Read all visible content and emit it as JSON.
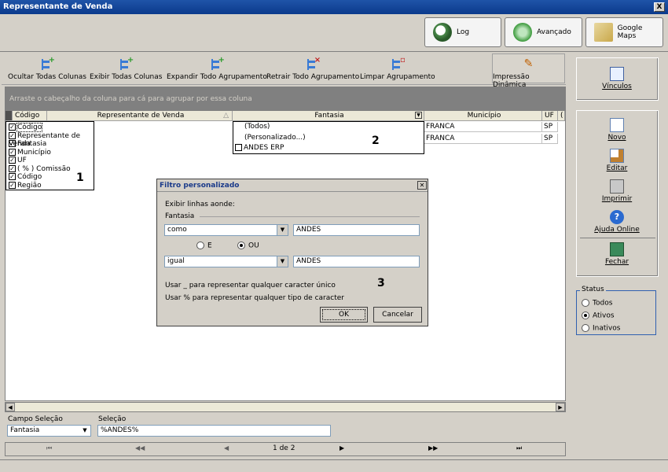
{
  "window": {
    "title": "Representante de Venda",
    "close": "X"
  },
  "top_buttons": [
    {
      "label": "Log",
      "icon": "magnifier-icon"
    },
    {
      "label": "Avançado",
      "icon": "globe-arrow-icon"
    },
    {
      "label": "Google Maps",
      "icon": "map-icon"
    }
  ],
  "toolbar": {
    "hide_all_columns": "Ocultar Todas Colunas",
    "show_all_columns": "Exibir Todas  Colunas",
    "expand_groups": "Expandir Todo Agrupamento",
    "collapse_groups": "Retrair Todo Agrupamento",
    "clear_groups": "Limpar Agrupamento",
    "dynamic_print": "Impressão Dinâmica"
  },
  "group_hint": "Arraste o cabeçalho da coluna para cá para agrupar por essa coluna",
  "grid": {
    "headers": [
      "Código",
      "Representante de Venda",
      "Fantasia",
      "Município",
      "UF",
      "("
    ],
    "rows": [
      {
        "municipio": "FRANCA",
        "uf": "SP"
      },
      {
        "municipio": "FRANCA",
        "uf": "SP"
      }
    ]
  },
  "column_chooser": {
    "items": [
      "Código",
      "Representante de Venda",
      "Fantasia",
      "Município",
      "UF",
      "( % ) Comissão",
      "Código",
      "Região"
    ],
    "marker": "1"
  },
  "filter_dropdown": {
    "items": [
      "(Todos)",
      "(Personalizado...)",
      "ANDES ERP"
    ],
    "marker": "2"
  },
  "custom_filter": {
    "title": "Filtro personalizado",
    "intro": "Exibir linhas aonde:",
    "field": "Fantasia",
    "op1": "como",
    "val1": "ANDES",
    "and_label": "E",
    "or_label": "OU",
    "op2": "igual",
    "val2": "ANDES",
    "hint1": "Usar _ para representar qualquer caracter único",
    "hint2": "Usar % para representar qualquer tipo de caracter",
    "ok": "OK",
    "cancel": "Cancelar",
    "marker": "3"
  },
  "bottom": {
    "field_label": "Campo Seleção",
    "field_value": "Fantasia",
    "selection_label": "Seleção",
    "selection_value": "%ANDES%",
    "page": "1 de 2"
  },
  "sidebar": {
    "links": "Vínculos",
    "new": "Novo",
    "edit": "Editar",
    "print": "Imprimir",
    "help": "Ajuda Online",
    "close": "Fechar",
    "status_title": "Status",
    "status_all": "Todos",
    "status_active": "Ativos",
    "status_inactive": "Inativos"
  },
  "colors": {
    "title_bar": "#1f54a8",
    "group_bar": "#808080",
    "accent": "#3a7bd5"
  }
}
